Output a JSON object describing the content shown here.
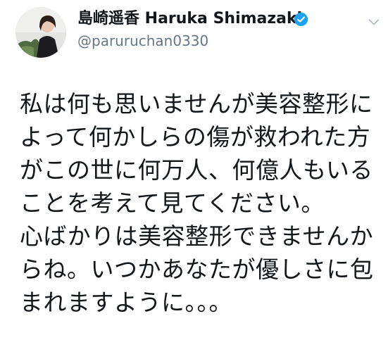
{
  "header": {
    "display_name": "島崎遥香 Haruka Shimazaki",
    "handle": "@paruruchan0330"
  },
  "icons": {
    "avatar": "profile-photo",
    "verified": "verified-check-icon",
    "menu": "chevron-down-icon"
  },
  "colors": {
    "verified": "#1da1f2",
    "handle": "#657786",
    "text": "#14171a"
  },
  "tweet": {
    "lines": [
      "私は何も思いませんが美容整形に",
      "よって何かしらの傷が救われた方",
      "がこの世に何万人、何億人もいる",
      "ことを考えて見てください。",
      "心ばかりは美容整形できませんか",
      "らね。いつかあなたが優しさに包",
      "まれますように。。。"
    ]
  }
}
